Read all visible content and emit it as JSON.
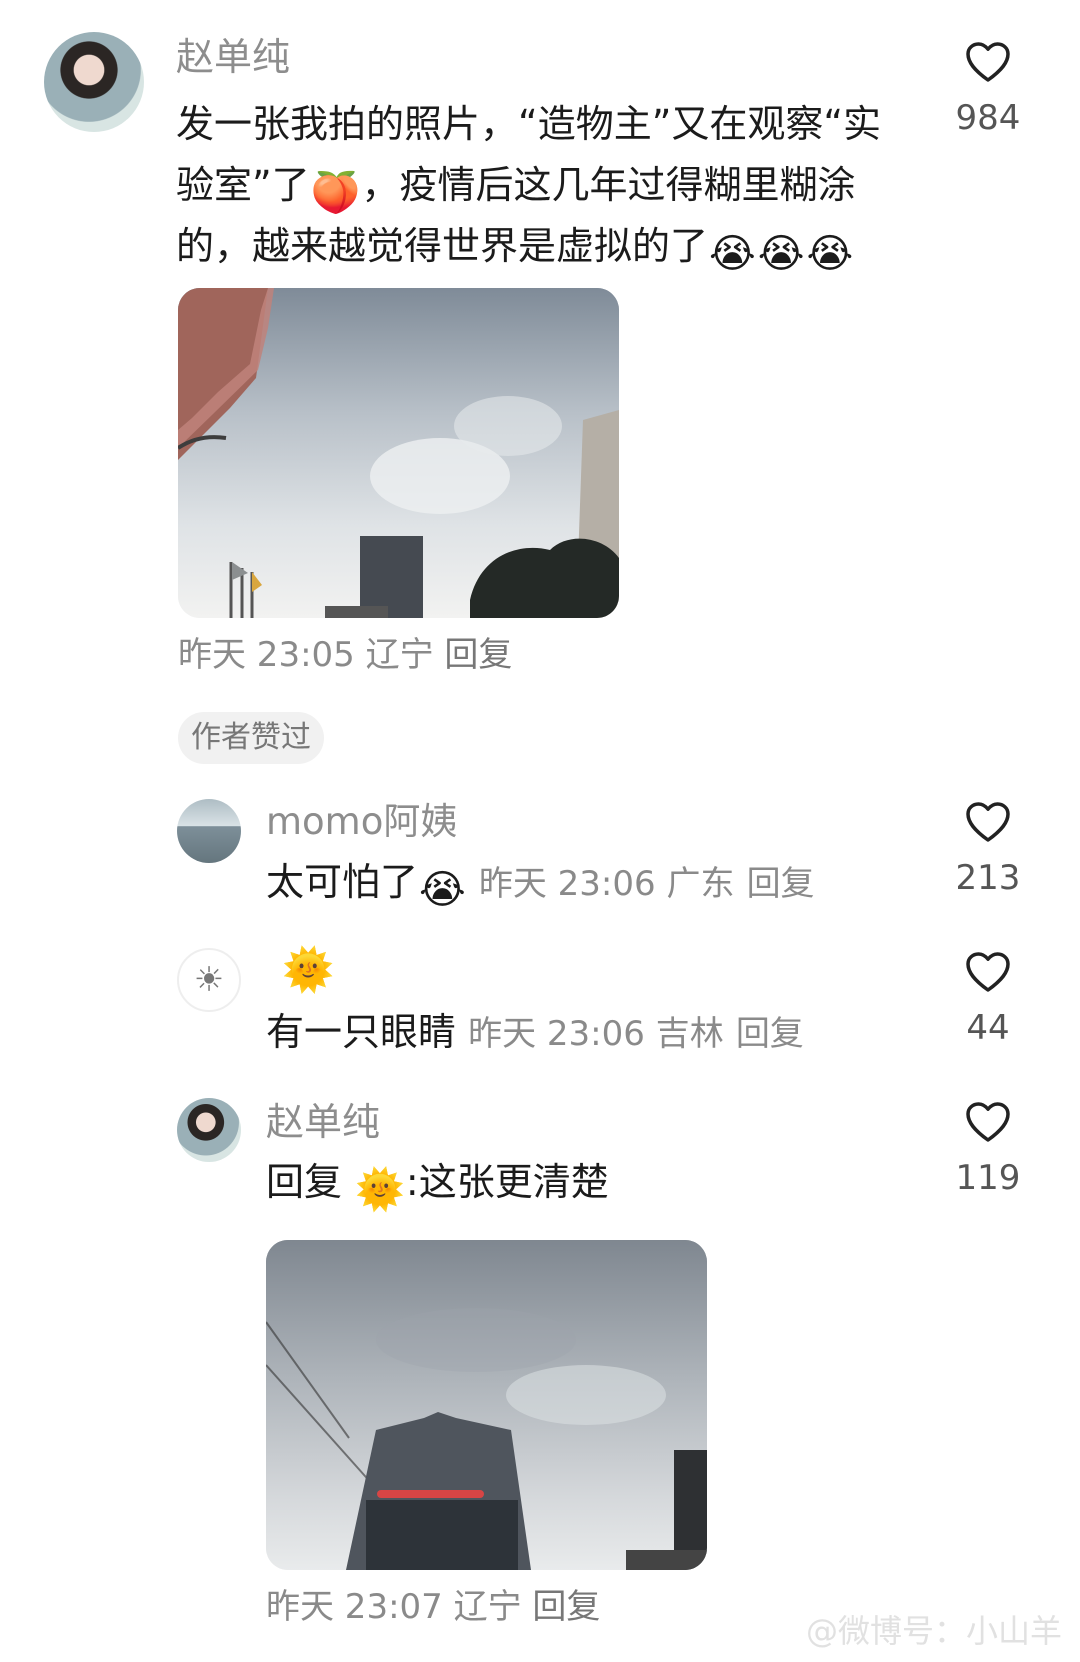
{
  "post": {
    "username": "赵单纯",
    "lines": [
      "发一张我拍的照片，“造物主”又在观察“实",
      "验室”了",
      "，疫情后这几年过得糊里糊涂",
      "的，越来越觉得世界是虚拟的了"
    ],
    "like_count": "984",
    "meta": "昨天 23:05 辽宁",
    "reply_label": "回复",
    "author_badge": "作者赞过"
  },
  "emojis": {
    "peach": "🍑",
    "crying": "😭",
    "sun": "🌞",
    "small_sun": "☀"
  },
  "comments": [
    {
      "username": "momo阿姨",
      "text": "太可怕了",
      "meta": "昨天 23:06 广东",
      "reply_label": "回复",
      "like_count": "213"
    },
    {
      "username": "🌞",
      "text": "有一只眼睛",
      "meta": "昨天 23:06 吉林",
      "reply_label": "回复",
      "like_count": "44"
    },
    {
      "username": "赵单纯",
      "prefix": "回复",
      "reply_to_emoji": "🌞",
      "text": ":这张更清楚",
      "meta": "昨天 23:07 辽宁",
      "reply_label": "回复",
      "like_count": "119"
    }
  ],
  "watermark": "@微博号：小山羊"
}
